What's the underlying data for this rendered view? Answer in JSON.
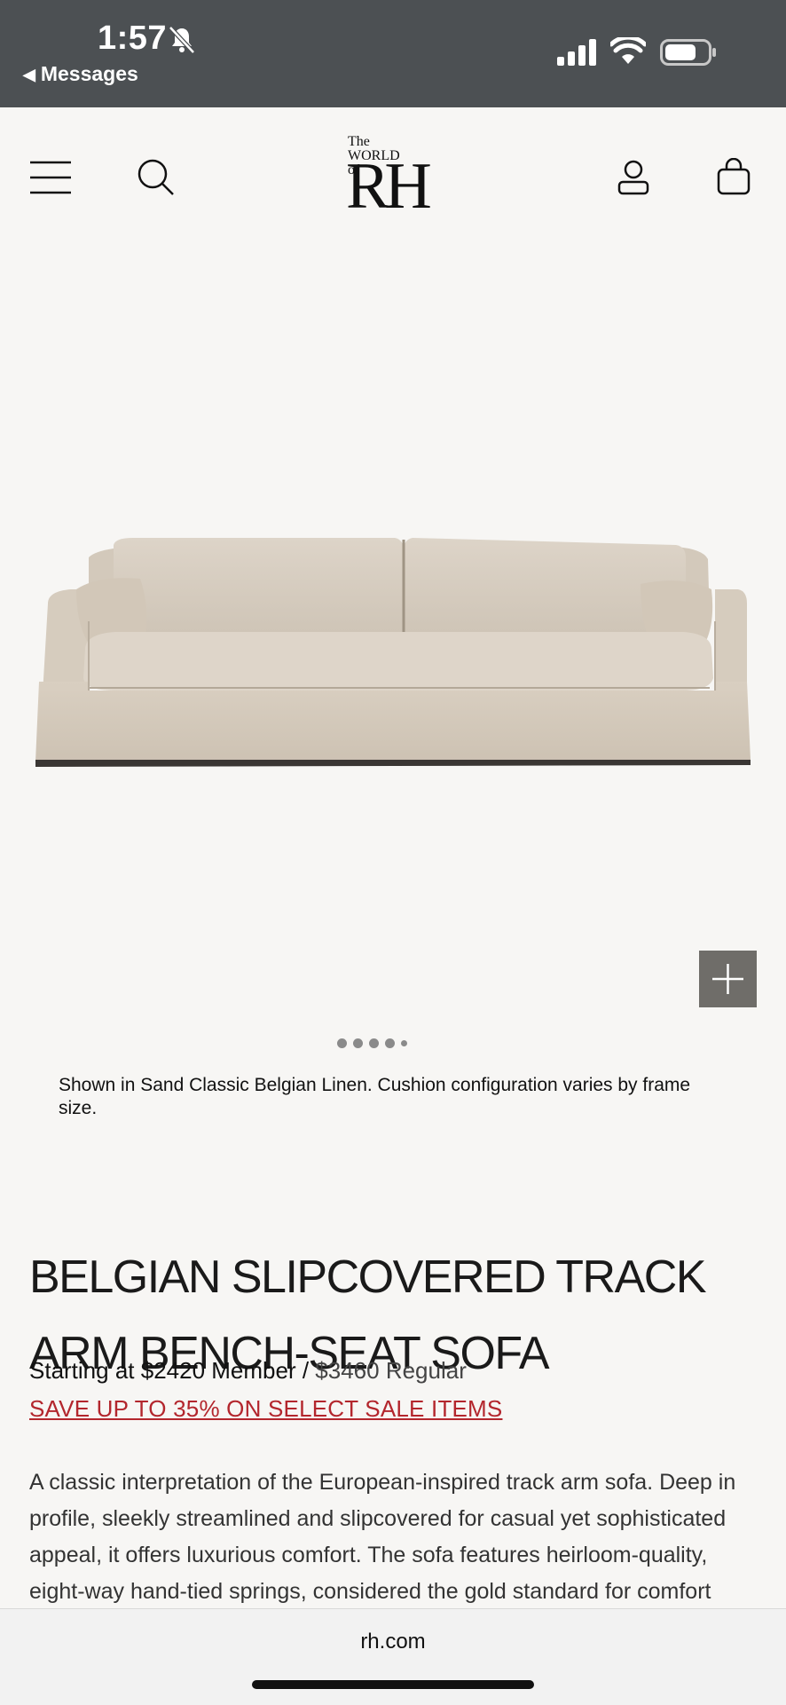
{
  "status_bar": {
    "time": "1:57",
    "back_label": "Messages",
    "icons": [
      "bell-slash-icon",
      "cellular-signal-icon",
      "wifi-icon",
      "battery-icon"
    ]
  },
  "header": {
    "logo_small": "The WORLD of",
    "logo_large": "RH",
    "icons": [
      "menu-icon",
      "search-icon",
      "account-icon",
      "cart-icon"
    ]
  },
  "hero": {
    "image_alt": "Belgian Slipcovered Track Arm Bench-Seat Sofa in Sand linen",
    "zoom_icon": "plus-icon",
    "carousel_count": 5,
    "carousel_active": 0,
    "caption": "Shown in Sand Classic Belgian Linen. Cushion configuration varies by frame size."
  },
  "product": {
    "title": "BELGIAN SLIPCOVERED TRACK ARM BENCH-SEAT SOFA",
    "price_member": "Starting at $2420 Member /",
    "price_regular": "$3460 Regular",
    "sale_link": "SAVE UP TO 35% ON SELECT SALE ITEMS",
    "description": "A classic interpretation of the European-inspired track arm sofa. Deep in profile, sleekly streamlined and slipcovered for casual yet sophisticated appeal, it offers luxurious comfort. The sofa features heirloom-quality, eight-way hand-tied springs, considered the gold standard for comfort"
  },
  "browser": {
    "url": "rh.com"
  },
  "colors": {
    "status_bar_bg": "#4c5053",
    "page_bg": "#f7f6f4",
    "sale_red": "#b3262d",
    "zoom_button": "#6f6d69",
    "sofa_linen": "#d8cfc2"
  }
}
